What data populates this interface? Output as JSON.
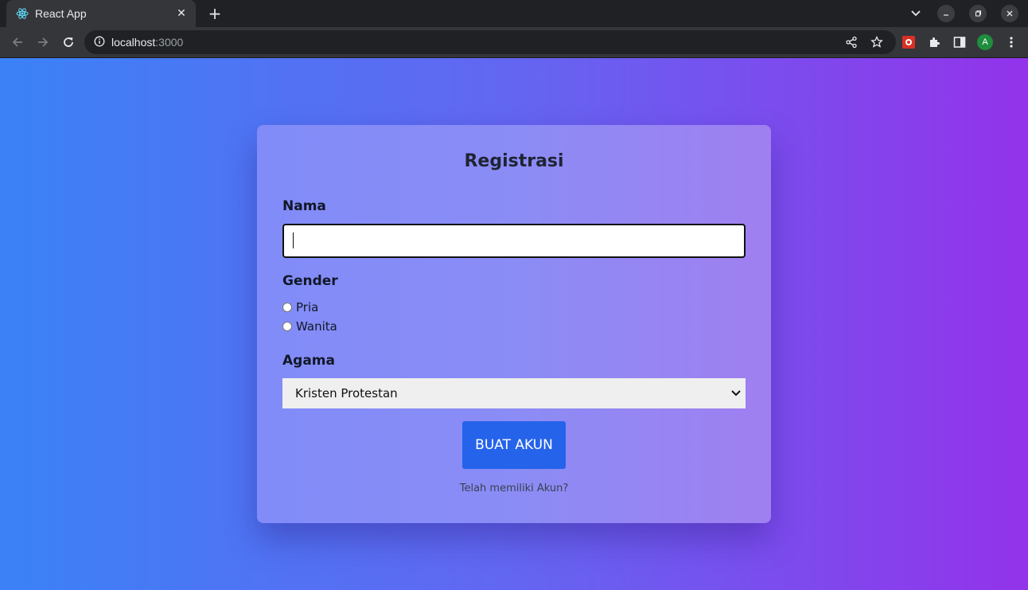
{
  "browser": {
    "tab_title": "React App",
    "url_host": "localhost",
    "url_port": ":3000",
    "profile_initial": "A"
  },
  "form": {
    "title": "Registrasi",
    "name_label": "Nama",
    "name_value": "",
    "gender_label": "Gender",
    "gender_options": [
      "Pria",
      "Wanita"
    ],
    "agama_label": "Agama",
    "agama_selected": "Kristen Protestan",
    "submit_label": "BUAT AKUN",
    "login_link": "Telah memiliki Akun?"
  },
  "colors": {
    "gradient_start": "#3b82f6",
    "gradient_end": "#9333ea",
    "button": "#2563eb"
  }
}
